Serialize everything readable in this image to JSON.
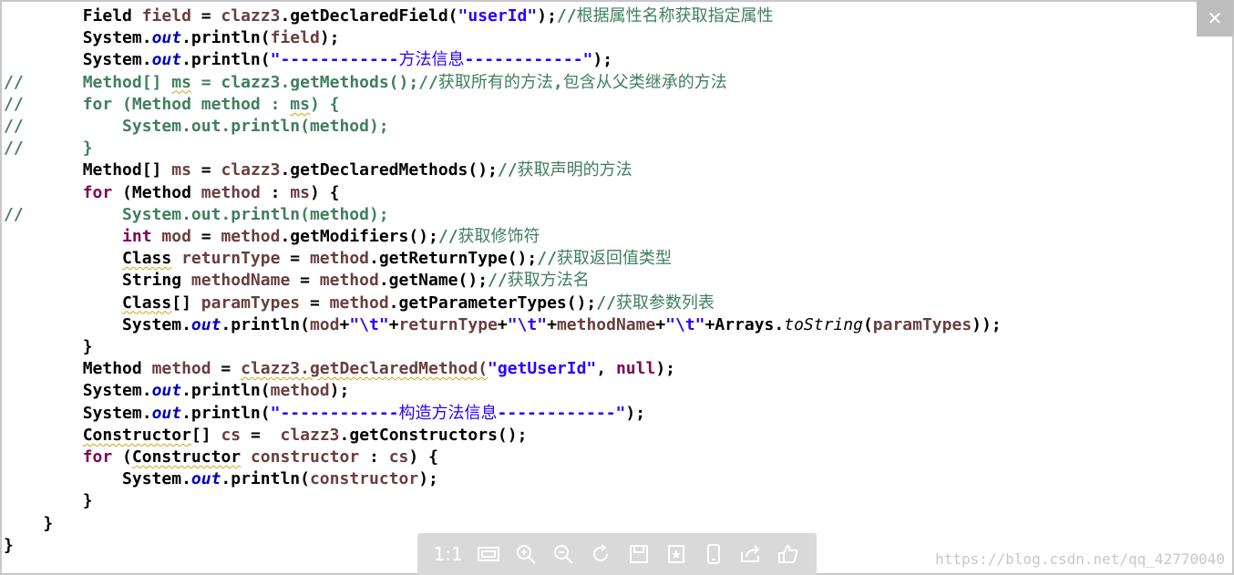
{
  "code_lines": [
    {
      "id": "l1",
      "segs": [
        [
          "t",
          "        Field "
        ],
        [
          "var",
          "field"
        ],
        [
          "t",
          " = "
        ],
        [
          "var",
          "clazz3"
        ],
        [
          "t",
          ".getDeclaredField("
        ],
        [
          "str",
          "\"userId\""
        ],
        [
          "t",
          ");"
        ],
        [
          "cm",
          "//根据属性名称获取指定属性"
        ]
      ]
    },
    {
      "id": "l2",
      "segs": [
        [
          "t",
          "        System."
        ],
        [
          "st",
          "out"
        ],
        [
          "t",
          ".println("
        ],
        [
          "var",
          "field"
        ],
        [
          "t",
          ");"
        ]
      ]
    },
    {
      "id": "l3",
      "segs": [
        [
          "t",
          "        System."
        ],
        [
          "st",
          "out"
        ],
        [
          "t",
          ".println("
        ],
        [
          "str",
          "\"------------方法信息------------\""
        ],
        [
          "t",
          ");"
        ]
      ]
    },
    {
      "id": "l4",
      "segs": [
        [
          "cm",
          "//      Method[] "
        ],
        [
          "cmu",
          "ms"
        ],
        [
          "cm",
          " = clazz3.getMethods();//获取所有的方法,包含从父类继承的方法"
        ]
      ]
    },
    {
      "id": "l5",
      "segs": [
        [
          "cm",
          "//      for (Method method : "
        ],
        [
          "cmu",
          "ms"
        ],
        [
          "cm",
          ") {"
        ]
      ]
    },
    {
      "id": "l6",
      "segs": [
        [
          "cm",
          "//          System.out.println(method);"
        ]
      ]
    },
    {
      "id": "l7",
      "segs": [
        [
          "cm",
          "//      }"
        ]
      ]
    },
    {
      "id": "l8",
      "segs": [
        [
          "t",
          "        Method[] "
        ],
        [
          "var",
          "ms"
        ],
        [
          "t",
          " = "
        ],
        [
          "var",
          "clazz3"
        ],
        [
          "t",
          ".getDeclaredMethods();"
        ],
        [
          "cm",
          "//获取声明的方法"
        ]
      ]
    },
    {
      "id": "l9",
      "segs": [
        [
          "t",
          "        "
        ],
        [
          "kw",
          "for"
        ],
        [
          "t",
          " (Method "
        ],
        [
          "var",
          "method"
        ],
        [
          "t",
          " : "
        ],
        [
          "var",
          "ms"
        ],
        [
          "t",
          ") {"
        ]
      ]
    },
    {
      "id": "l10",
      "segs": [
        [
          "cm",
          "//          System.out.println(method);"
        ]
      ]
    },
    {
      "id": "l11",
      "segs": [
        [
          "t",
          "            "
        ],
        [
          "kw",
          "int"
        ],
        [
          "t",
          " "
        ],
        [
          "var",
          "mod"
        ],
        [
          "t",
          " = "
        ],
        [
          "var",
          "method"
        ],
        [
          "t",
          ".getModifiers();"
        ],
        [
          "cm",
          "//获取修饰符"
        ]
      ]
    },
    {
      "id": "l12",
      "segs": [
        [
          "t",
          "            "
        ],
        [
          "u",
          "Class"
        ],
        [
          "t",
          " "
        ],
        [
          "var",
          "returnType"
        ],
        [
          "t",
          " = "
        ],
        [
          "var",
          "method"
        ],
        [
          "t",
          ".getReturnType();"
        ],
        [
          "cm",
          "//获取返回值类型"
        ]
      ]
    },
    {
      "id": "l13",
      "segs": [
        [
          "t",
          "            String "
        ],
        [
          "var",
          "methodName"
        ],
        [
          "t",
          " = "
        ],
        [
          "var",
          "method"
        ],
        [
          "t",
          ".getName();"
        ],
        [
          "cm",
          "//获取方法名"
        ]
      ]
    },
    {
      "id": "l14",
      "segs": [
        [
          "t",
          "            "
        ],
        [
          "u",
          "Class"
        ],
        [
          "t",
          "[] "
        ],
        [
          "var",
          "paramTypes"
        ],
        [
          "t",
          " = "
        ],
        [
          "var",
          "method"
        ],
        [
          "t",
          ".getParameterTypes();"
        ],
        [
          "cm",
          "//获取参数列表"
        ]
      ]
    },
    {
      "id": "l15",
      "segs": [
        [
          "t",
          "            System."
        ],
        [
          "st",
          "out"
        ],
        [
          "t",
          ".println("
        ],
        [
          "var",
          "mod"
        ],
        [
          "t",
          "+"
        ],
        [
          "str",
          "\"\\t\""
        ],
        [
          "t",
          "+"
        ],
        [
          "var",
          "returnType"
        ],
        [
          "t",
          "+"
        ],
        [
          "str",
          "\"\\t\""
        ],
        [
          "t",
          "+"
        ],
        [
          "var",
          "methodName"
        ],
        [
          "t",
          "+"
        ],
        [
          "str",
          "\"\\t\""
        ],
        [
          "t",
          "+Arrays."
        ],
        [
          "it",
          "toString"
        ],
        [
          "t",
          "("
        ],
        [
          "var",
          "paramTypes"
        ],
        [
          "t",
          "));"
        ]
      ]
    },
    {
      "id": "l16",
      "segs": [
        [
          "t",
          "        }"
        ]
      ]
    },
    {
      "id": "l17",
      "segs": [
        [
          "t",
          "        Method "
        ],
        [
          "var",
          "method"
        ],
        [
          "t",
          " = "
        ],
        [
          "varu",
          "clazz3.getDeclaredMethod("
        ],
        [
          "str",
          "\"getUserId\""
        ],
        [
          "t",
          ", "
        ],
        [
          "kw",
          "null"
        ],
        [
          "t",
          ");"
        ]
      ]
    },
    {
      "id": "l18",
      "segs": [
        [
          "t",
          "        System."
        ],
        [
          "st",
          "out"
        ],
        [
          "t",
          ".println("
        ],
        [
          "var",
          "method"
        ],
        [
          "t",
          ");"
        ]
      ]
    },
    {
      "id": "l19",
      "segs": [
        [
          "t",
          "        System."
        ],
        [
          "st",
          "out"
        ],
        [
          "t",
          ".println("
        ],
        [
          "str",
          "\"------------构造方法信息------------\""
        ],
        [
          "t",
          ");"
        ]
      ]
    },
    {
      "id": "l20",
      "segs": [
        [
          "t",
          "        "
        ],
        [
          "u",
          "Constructor"
        ],
        [
          "t",
          "[] "
        ],
        [
          "var",
          "cs"
        ],
        [
          "t",
          " =  "
        ],
        [
          "var",
          "clazz3"
        ],
        [
          "t",
          ".getConstructors();"
        ]
      ]
    },
    {
      "id": "l21",
      "segs": [
        [
          "t",
          "        "
        ],
        [
          "kw",
          "for"
        ],
        [
          "t",
          " ("
        ],
        [
          "u",
          "Constructor"
        ],
        [
          "t",
          " "
        ],
        [
          "var",
          "constructor"
        ],
        [
          "t",
          " : "
        ],
        [
          "var",
          "cs"
        ],
        [
          "t",
          ") {"
        ]
      ]
    },
    {
      "id": "l22",
      "segs": [
        [
          "t",
          "            System."
        ],
        [
          "st",
          "out"
        ],
        [
          "t",
          ".println("
        ],
        [
          "var",
          "constructor"
        ],
        [
          "t",
          ");"
        ]
      ]
    },
    {
      "id": "l23",
      "segs": [
        [
          "t",
          "        }"
        ]
      ]
    },
    {
      "id": "l24",
      "segs": [
        [
          "t",
          "    }"
        ]
      ]
    },
    {
      "id": "l25",
      "segs": [
        [
          "t",
          "}"
        ]
      ]
    }
  ],
  "viewer": {
    "close_label": "✕",
    "toolbar": [
      {
        "name": "actual-size",
        "label": "1:1"
      },
      {
        "name": "fit-window-icon",
        "label": ""
      },
      {
        "name": "zoom-in-icon",
        "label": ""
      },
      {
        "name": "zoom-out-icon",
        "label": ""
      },
      {
        "name": "rotate-icon",
        "label": ""
      },
      {
        "name": "save-icon",
        "label": ""
      },
      {
        "name": "bookmark-icon",
        "label": ""
      },
      {
        "name": "phone-icon",
        "label": ""
      },
      {
        "name": "share-icon",
        "label": ""
      },
      {
        "name": "like-icon",
        "label": ""
      }
    ]
  },
  "watermark": "https://blog.csdn.net/qq_42770040"
}
